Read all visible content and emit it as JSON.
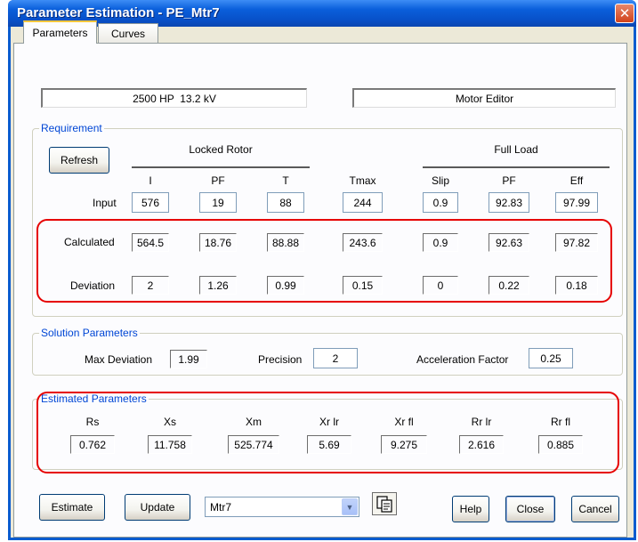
{
  "window": {
    "title": "Parameter Estimation - PE_Mtr7",
    "close_glyph": "✕"
  },
  "tabs": [
    {
      "label": "Parameters",
      "active": true
    },
    {
      "label": "Curves",
      "active": false
    }
  ],
  "header": {
    "motor_rating": "2500 HP  13.2 kV",
    "editor_name": "Motor Editor"
  },
  "requirement": {
    "group_label": "Requirement",
    "refresh_label": "Refresh",
    "locked_rotor_header": "Locked Rotor",
    "full_load_header": "Full Load",
    "columns": [
      "I",
      "PF",
      "T",
      "Tmax",
      "Slip",
      "PF",
      "Eff"
    ],
    "input_label": "Input",
    "inputs": [
      "576",
      "19",
      "88",
      "244",
      "0.9",
      "92.83",
      "97.99"
    ],
    "calculated_label": "Calculated",
    "calculated": [
      "564.5",
      "18.76",
      "88.88",
      "243.6",
      "0.9",
      "92.63",
      "97.82"
    ],
    "deviation_label": "Deviation",
    "deviation": [
      "2",
      "1.26",
      "0.99",
      "0.15",
      "0",
      "0.22",
      "0.18"
    ]
  },
  "solution": {
    "group_label": "Solution Parameters",
    "max_deviation_label": "Max Deviation",
    "max_deviation": "1.99",
    "precision_label": "Precision",
    "precision": "2",
    "acceleration_label": "Acceleration Factor",
    "acceleration": "0.25"
  },
  "estimated": {
    "group_label": "Estimated Parameters",
    "columns": [
      "Rs",
      "Xs",
      "Xm",
      "Xr lr",
      "Xr fl",
      "Rr lr",
      "Rr fl"
    ],
    "values": [
      "0.762",
      "11.758",
      "525.774",
      "5.69",
      "9.275",
      "2.616",
      "0.885"
    ]
  },
  "footer": {
    "estimate_label": "Estimate",
    "update_label": "Update",
    "combo_value": "Mtr7",
    "help_label": "Help",
    "close_label": "Close",
    "cancel_label": "Cancel"
  },
  "highlight_color": "#e60000",
  "accent_color": "#0046d5"
}
